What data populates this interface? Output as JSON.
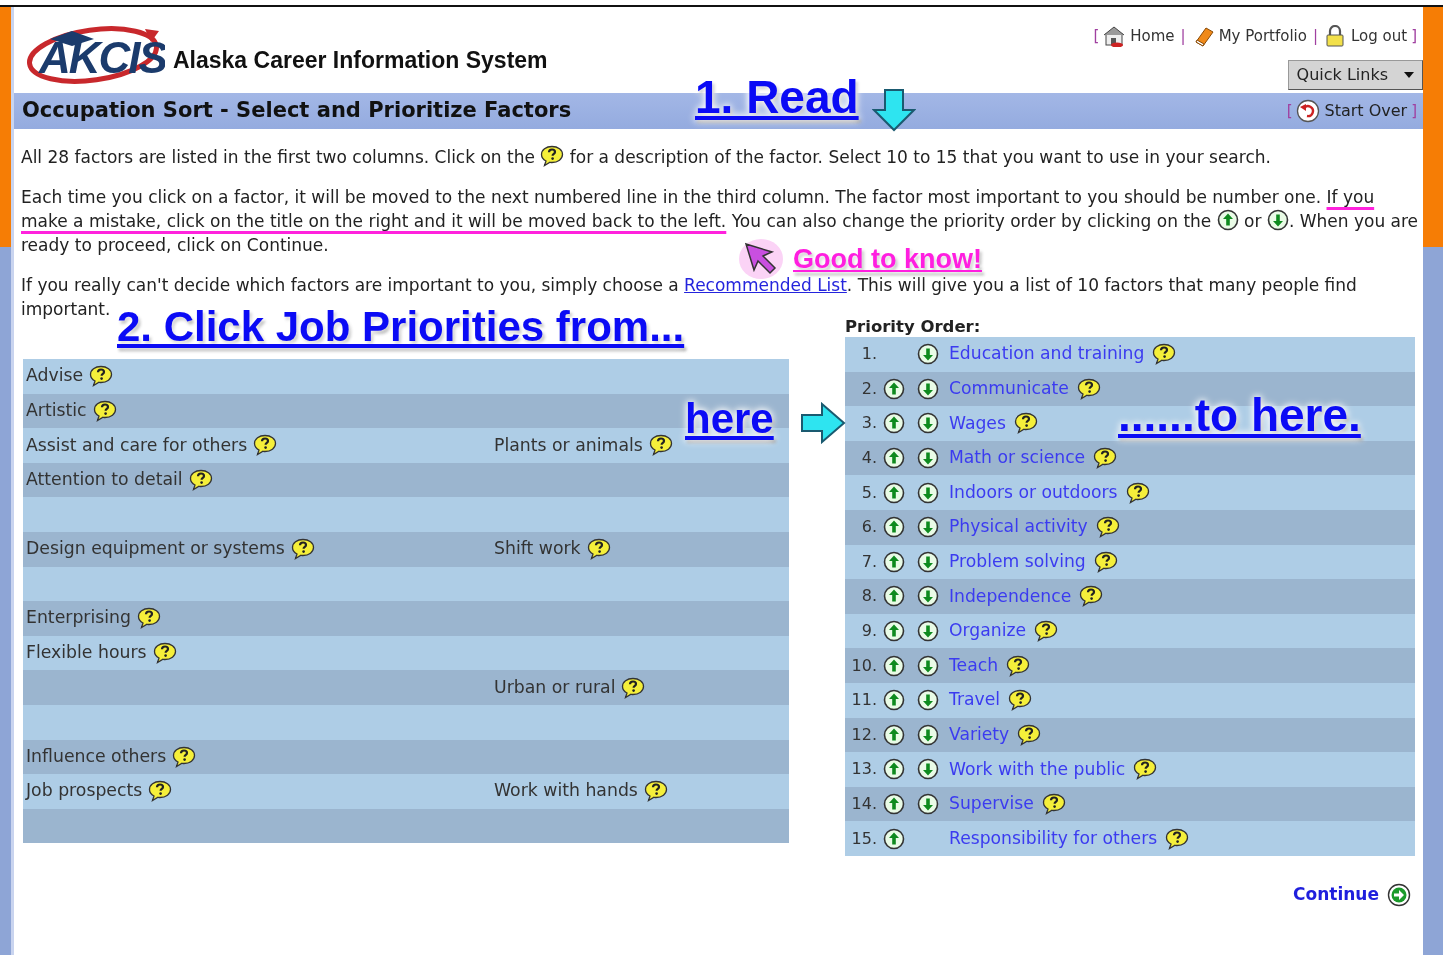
{
  "header": {
    "logo": "AKCIS",
    "site_title": "Alaska Career Information System",
    "nav_open": "[",
    "nav_close": "]",
    "nav_items": [
      {
        "label": "Home",
        "separator": "|"
      },
      {
        "label": "My Portfolio",
        "separator": "|"
      },
      {
        "label": "Log out"
      }
    ],
    "quick_links": "Quick Links"
  },
  "title_bar": {
    "title": "Occupation Sort - Select and Prioritize Factors",
    "start_open": "[",
    "start_over": "Start Over",
    "start_close": "]"
  },
  "instructions": [
    [
      {
        "kind": "text",
        "text": "All 28 factors are listed in the first two columns. Click on the "
      },
      {
        "kind": "help"
      },
      {
        "kind": "text",
        "text": " for a description of the factor. Select 10 to 15 that you want to use in your search."
      }
    ],
    [
      {
        "kind": "text",
        "text": "Each time you click on a factor, it will be moved to the next numbered line in the third column. The factor most important to you should be number one. "
      },
      {
        "kind": "highlight",
        "text": "If you make a mistake, click on the title on the right and it will be moved back to the left."
      },
      {
        "kind": "text",
        "text": " You can also change the priority order by clicking on the "
      },
      {
        "kind": "up"
      },
      {
        "kind": "text",
        "text": " or "
      },
      {
        "kind": "down"
      },
      {
        "kind": "text",
        "text": ". When you are ready to proceed, click on Continue."
      }
    ],
    [
      {
        "kind": "text",
        "text": "If you really can't decide which factors are important to you, simply choose a "
      },
      {
        "kind": "link",
        "text": "Recommended List"
      },
      {
        "kind": "text",
        "text": ". This will give you a list of 10 factors that many people find important."
      }
    ]
  ],
  "annotations": [
    {
      "kind": "read",
      "text": "1. Read"
    },
    {
      "kind": "good",
      "text": "Good to know!"
    },
    {
      "kind": "click",
      "text": "2. Click Job Priorities from..."
    },
    {
      "kind": "here",
      "text": "here"
    },
    {
      "kind": "to-here",
      "text": "......to here."
    }
  ],
  "factors": [
    {
      "kind": "factor",
      "left": "Advise"
    },
    {
      "kind": "factor",
      "left": "Artistic"
    },
    {
      "kind": "factor",
      "left": "Assist and care for others",
      "right": "Plants or animals"
    },
    {
      "kind": "factor",
      "left": "Attention to detail"
    },
    {
      "kind": "blank"
    },
    {
      "kind": "factor",
      "left": "Design equipment or systems",
      "right": "Shift work"
    },
    {
      "kind": "blank"
    },
    {
      "kind": "factor",
      "left": "Enterprising"
    },
    {
      "kind": "factor",
      "left": "Flexible hours"
    },
    {
      "kind": "factor",
      "right": "Urban or rural"
    },
    {
      "kind": "blank"
    },
    {
      "kind": "factor",
      "left": "Influence others"
    },
    {
      "kind": "factor",
      "left": "Job prospects",
      "right": "Work with hands"
    },
    {
      "kind": "blank"
    }
  ],
  "priority": {
    "heading": "Priority Order:",
    "items": [
      {
        "number": "1.",
        "label": "Education and training",
        "up": false,
        "down": true
      },
      {
        "number": "2.",
        "label": "Communicate",
        "up": true,
        "down": true
      },
      {
        "number": "3.",
        "label": "Wages",
        "up": true,
        "down": true
      },
      {
        "number": "4.",
        "label": "Math or science",
        "up": true,
        "down": true
      },
      {
        "number": "5.",
        "label": "Indoors or outdoors",
        "up": true,
        "down": true
      },
      {
        "number": "6.",
        "label": "Physical activity",
        "up": true,
        "down": true
      },
      {
        "number": "7.",
        "label": "Problem solving",
        "up": true,
        "down": true
      },
      {
        "number": "8.",
        "label": "Independence",
        "up": true,
        "down": true
      },
      {
        "number": "9.",
        "label": "Organize",
        "up": true,
        "down": true
      },
      {
        "number": "10.",
        "label": "Teach",
        "up": true,
        "down": true
      },
      {
        "number": "11.",
        "label": "Travel",
        "up": true,
        "down": true
      },
      {
        "number": "12.",
        "label": "Variety",
        "up": true,
        "down": true
      },
      {
        "number": "13.",
        "label": "Work with the public",
        "up": true,
        "down": true
      },
      {
        "number": "14.",
        "label": "Supervise",
        "up": true,
        "down": true
      },
      {
        "number": "15.",
        "label": "Responsibility for others",
        "up": true,
        "down": false
      }
    ]
  },
  "continue": "Continue"
}
